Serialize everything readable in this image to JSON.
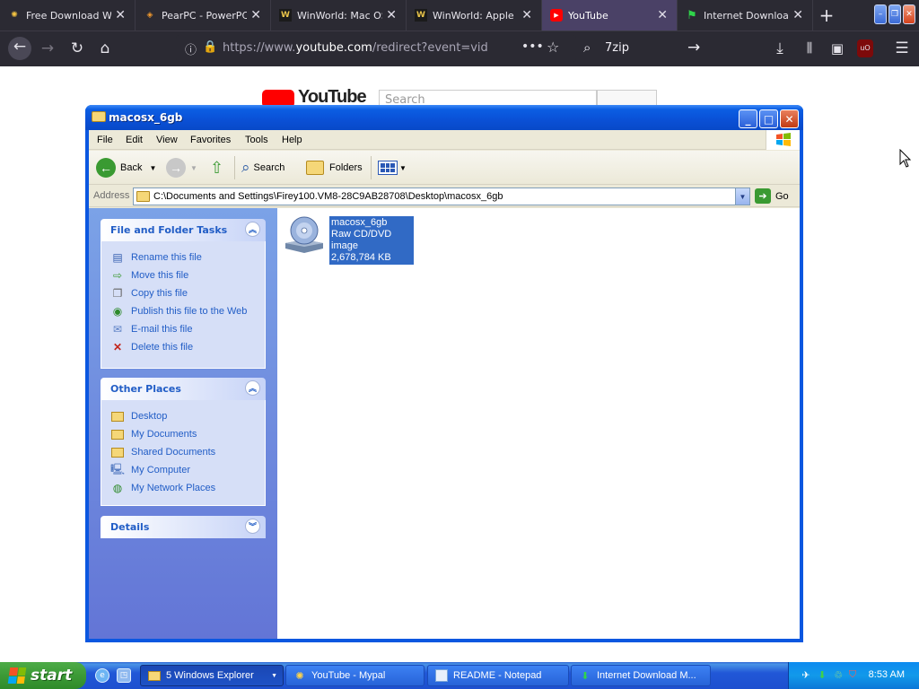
{
  "browser": {
    "tabs": [
      {
        "title": "Free Download We",
        "icon": "pinwheel-icon",
        "active": false
      },
      {
        "title": "PearPC - PowerPC",
        "icon": "pear-icon",
        "active": false
      },
      {
        "title": "WinWorld: Mac OS",
        "icon": "winworld-icon",
        "active": false
      },
      {
        "title": "WinWorld: Apple N",
        "icon": "winworld-icon",
        "active": false
      },
      {
        "title": "YouTube",
        "icon": "youtube-icon",
        "active": true
      },
      {
        "title": "Internet Download",
        "icon": "idm-flag-icon",
        "active": false
      }
    ],
    "new_tab": "+",
    "url_prefix": "https://www.",
    "url_domain": "youtube.com",
    "url_rest": "/redirect?event=video_de",
    "search_text": "7zip",
    "accent": "#4a4166"
  },
  "page_behind": {
    "logo_text": "YouTube",
    "search_placeholder": "Search"
  },
  "explorer": {
    "title": "macosx_6gb",
    "menu": [
      "File",
      "Edit",
      "View",
      "Favorites",
      "Tools",
      "Help"
    ],
    "toolbar": {
      "back": "Back",
      "search": "Search",
      "folders": "Folders"
    },
    "address_label": "Address",
    "address": "C:\\Documents and Settings\\Firey100.VM8-28C9AB28708\\Desktop\\macosx_6gb",
    "go": "Go",
    "task_pane": {
      "file_tasks": {
        "title": "File and Folder Tasks",
        "items": [
          "Rename this file",
          "Move this file",
          "Copy this file",
          "Publish this file to the Web",
          "E-mail this file",
          "Delete this file"
        ]
      },
      "other_places": {
        "title": "Other Places",
        "items": [
          "Desktop",
          "My Documents",
          "Shared Documents",
          "My Computer",
          "My Network Places"
        ]
      },
      "details": {
        "title": "Details"
      }
    },
    "file": {
      "name": "macosx_6gb",
      "type": "Raw CD/DVD image",
      "size": "2,678,784 KB"
    }
  },
  "taskbar": {
    "start": "start",
    "items": [
      {
        "label": "5 Windows Explorer",
        "icon": "folder-icon",
        "active": true
      },
      {
        "label": "YouTube - Mypal",
        "icon": "mypal-icon",
        "active": false
      },
      {
        "label": "README - Notepad",
        "icon": "notepad-icon",
        "active": false
      },
      {
        "label": "Internet Download M...",
        "icon": "idm-icon",
        "active": false
      }
    ],
    "clock": "8:53 AM"
  }
}
